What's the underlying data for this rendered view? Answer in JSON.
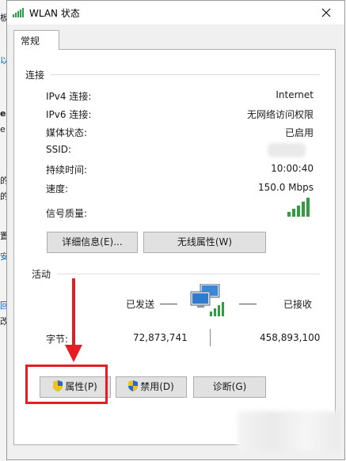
{
  "window": {
    "title": "WLAN 状态"
  },
  "tabs": [
    {
      "label": "常规"
    }
  ],
  "connection": {
    "group_label": "连接",
    "rows": [
      {
        "label": "IPv4 连接:",
        "value": "Internet"
      },
      {
        "label": "IPv6 连接:",
        "value": "无网络访问权限"
      },
      {
        "label": "媒体状态:",
        "value": "已启用"
      },
      {
        "label": "SSID:",
        "value": ""
      },
      {
        "label": "持续时间:",
        "value": "10:00:40"
      },
      {
        "label": "速度:",
        "value": "150.0 Mbps"
      },
      {
        "label": "信号质量:",
        "value": ""
      }
    ],
    "signal_bars": 5,
    "details_button": "详细信息(E)...",
    "wireless_button": "无线属性(W)"
  },
  "activity": {
    "group_label": "活动",
    "sent_label": "已发送",
    "received_label": "已接收",
    "bytes_label": "字节:",
    "bytes_sent": "72,873,741",
    "bytes_received": "458,893,100"
  },
  "buttons": {
    "properties": "属性(P)",
    "disable": "禁用(D)",
    "diagnose": "诊断(G)"
  },
  "background_fragments": [
    "板",
    "以",
    "e",
    "e",
    "的",
    "的",
    "置",
    "安",
    "回",
    "改"
  ],
  "colors": {
    "signal_green": "#2e9e3e",
    "highlight_red": "#e31e24",
    "shield_blue": "#2b67c6",
    "shield_yellow": "#f2c316"
  }
}
